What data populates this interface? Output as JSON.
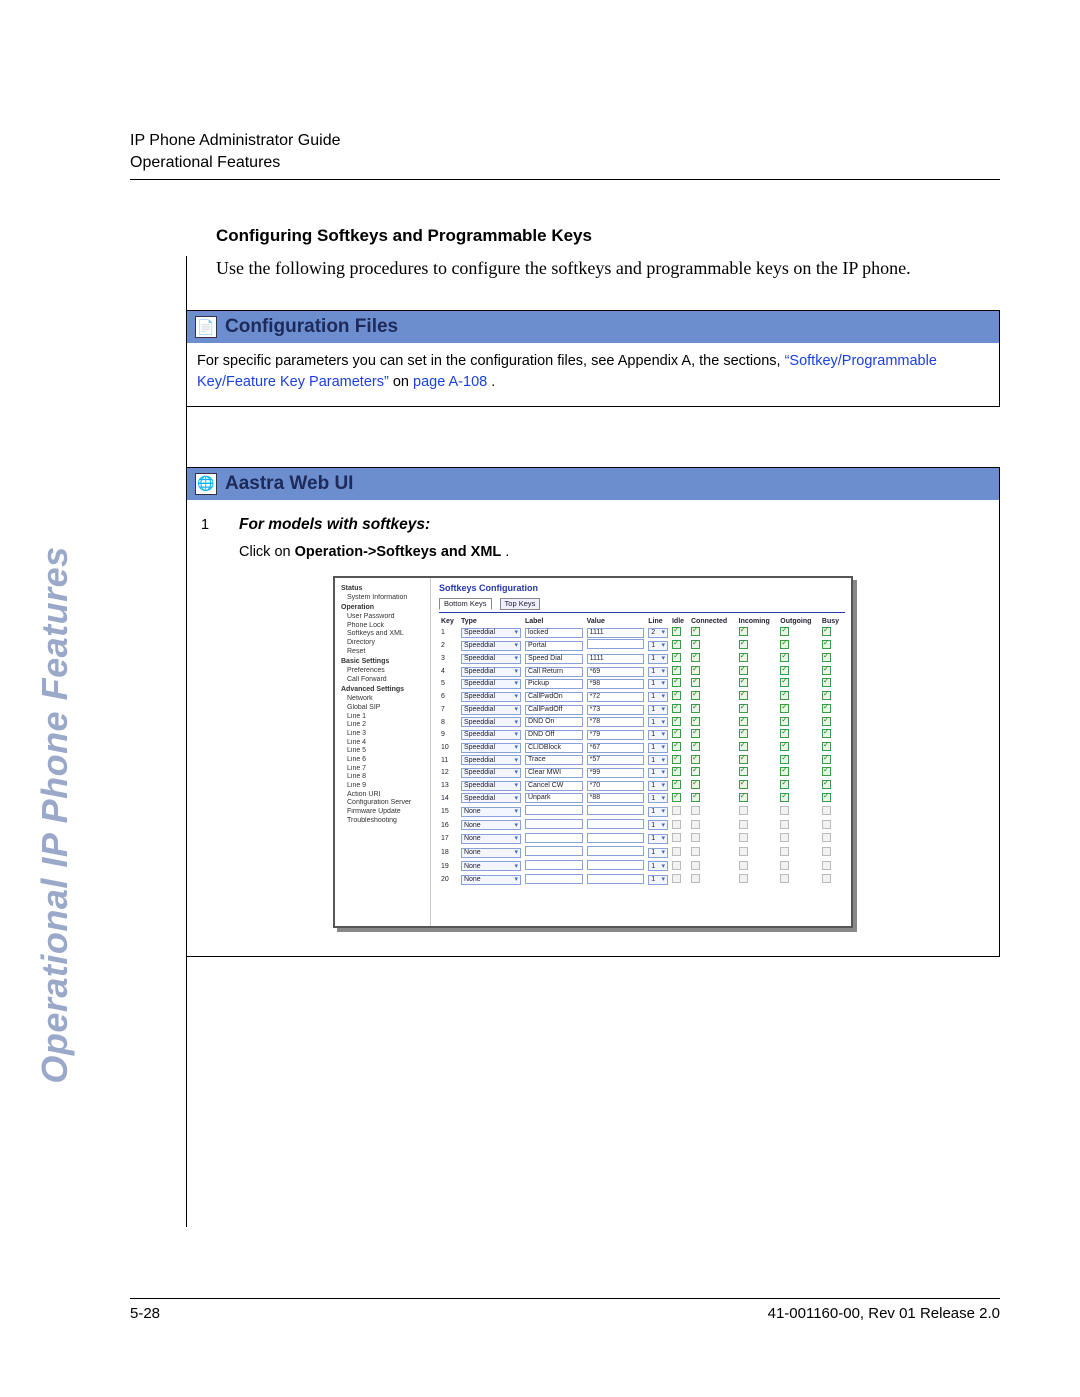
{
  "header": {
    "line1": "IP Phone Administrator Guide",
    "line2": "Operational Features"
  },
  "sidebar_vertical": "Operational IP Phone Features",
  "section_heading": "Configuring Softkeys and Programmable Keys",
  "intro_para": "Use the following procedures to configure the softkeys and programmable keys on the IP phone.",
  "config_box": {
    "title": "Configuration Files",
    "text_pre": "For specific parameters you can set in the configuration files, see Appendix A, the sections, ",
    "link_text": "“Softkey/Programmable Key/Feature Key Parameters”",
    "text_mid": " on ",
    "page_link": "page A-108",
    "text_post": "."
  },
  "web_box": {
    "title": "Aastra Web UI",
    "step_num": "1",
    "step_label": "For models with softkeys:",
    "step_text_pre": "Click on ",
    "step_text_bold": "Operation->Softkeys and XML",
    "step_text_post": "."
  },
  "shot": {
    "side": {
      "groups": [
        {
          "title": "Status",
          "items": [
            "System Information"
          ]
        },
        {
          "title": "Operation",
          "items": [
            "User Password",
            "Phone Lock",
            "Softkeys and XML",
            "Directory",
            "Reset"
          ]
        },
        {
          "title": "Basic Settings",
          "items": [
            "Preferences",
            "Call Forward"
          ]
        },
        {
          "title": "Advanced Settings",
          "items": [
            "Network",
            "Global SIP",
            "Line 1",
            "Line 2",
            "Line 3",
            "Line 4",
            "Line 5",
            "Line 6",
            "Line 7",
            "Line 8",
            "Line 9",
            "Action URI",
            "Configuration Server",
            "Firmware Update",
            "Troubleshooting"
          ]
        }
      ]
    },
    "main_title": "Softkeys Configuration",
    "tabs": {
      "active": "Bottom Keys",
      "other": "Top Keys"
    },
    "cols": [
      "Key",
      "Type",
      "Label",
      "Value",
      "Line",
      "Idle",
      "Connected",
      "Incoming",
      "Outgoing",
      "Busy"
    ],
    "rows": [
      {
        "k": 1,
        "type": "Speeddial",
        "label": "locked",
        "value": "1111",
        "line": "2",
        "on": true
      },
      {
        "k": 2,
        "type": "Speeddial",
        "label": "Portal",
        "value": "",
        "line": "1",
        "on": true
      },
      {
        "k": 3,
        "type": "Speeddial",
        "label": "Speed Dial",
        "value": "1111",
        "line": "1",
        "on": true
      },
      {
        "k": 4,
        "type": "Speeddial",
        "label": "Call Return",
        "value": "*69",
        "line": "1",
        "on": true
      },
      {
        "k": 5,
        "type": "Speeddial",
        "label": "Pickup",
        "value": "*98",
        "line": "1",
        "on": true
      },
      {
        "k": 6,
        "type": "Speeddial",
        "label": "CallFwdOn",
        "value": "*72",
        "line": "1",
        "on": true
      },
      {
        "k": 7,
        "type": "Speeddial",
        "label": "CallFwdOff",
        "value": "*73",
        "line": "1",
        "on": true
      },
      {
        "k": 8,
        "type": "Speeddial",
        "label": "DND On",
        "value": "*78",
        "line": "1",
        "on": true
      },
      {
        "k": 9,
        "type": "Speeddial",
        "label": "DND Off",
        "value": "*79",
        "line": "1",
        "on": true
      },
      {
        "k": 10,
        "type": "Speeddial",
        "label": "CLIDBlock",
        "value": "*67",
        "line": "1",
        "on": true
      },
      {
        "k": 11,
        "type": "Speeddial",
        "label": "Trace",
        "value": "*57",
        "line": "1",
        "on": true
      },
      {
        "k": 12,
        "type": "Speeddial",
        "label": "Clear MWI",
        "value": "*99",
        "line": "1",
        "on": true
      },
      {
        "k": 13,
        "type": "Speeddial",
        "label": "Cancel CW",
        "value": "*70",
        "line": "1",
        "on": true
      },
      {
        "k": 14,
        "type": "Speeddial",
        "label": "Unpark",
        "value": "*88",
        "line": "1",
        "on": true
      },
      {
        "k": 15,
        "type": "None",
        "label": "",
        "value": "",
        "line": "1",
        "on": false
      },
      {
        "k": 16,
        "type": "None",
        "label": "",
        "value": "",
        "line": "1",
        "on": false
      },
      {
        "k": 17,
        "type": "None",
        "label": "",
        "value": "",
        "line": "1",
        "on": false
      },
      {
        "k": 18,
        "type": "None",
        "label": "",
        "value": "",
        "line": "1",
        "on": false
      },
      {
        "k": 19,
        "type": "None",
        "label": "",
        "value": "",
        "line": "1",
        "on": false
      },
      {
        "k": 20,
        "type": "None",
        "label": "",
        "value": "",
        "line": "1",
        "on": false
      }
    ]
  },
  "footer": {
    "left": "5-28",
    "right": "41-001160-00, Rev 01  Release 2.0"
  }
}
